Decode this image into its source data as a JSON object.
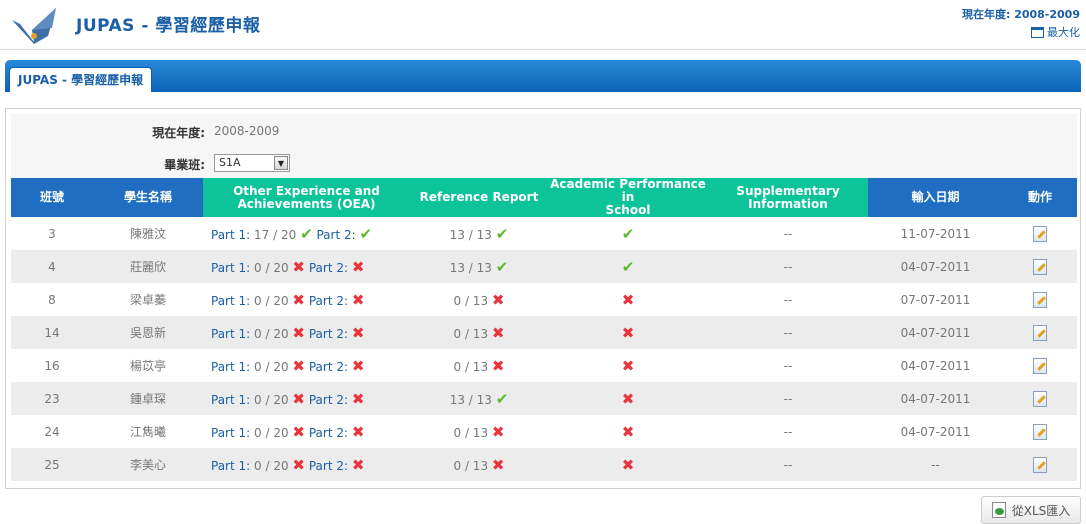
{
  "header": {
    "title": "JUPAS - 學習經歷申報",
    "year_label": "現在年度: 2008-2009",
    "maximize_label": "最大化"
  },
  "band": {
    "tab_label": "JUPAS - 學習經歷申報"
  },
  "filters": {
    "year_label": "現在年度:",
    "year_value": "2008-2009",
    "class_label": "畢業班:",
    "class_value": "S1A"
  },
  "table": {
    "headers": {
      "class_no": "班號",
      "student_name": "學生名稱",
      "oea_line1": "Other Experience and",
      "oea_line2": "Achievements (OEA)",
      "reference": "Reference Report",
      "academic_line1": "Academic Performance in",
      "academic_line2": "School",
      "supp_line1": "Supplementary",
      "supp_line2": "Information",
      "input_date": "輸入日期",
      "action": "動作"
    },
    "part1_label": "Part 1:",
    "part2_label": "Part 2:",
    "rows": [
      {
        "no": "3",
        "name": "陳雅汶",
        "oea": "17 / 20",
        "p1": "ok",
        "p2": "ok",
        "ref": "13 / 13",
        "ref_s": "ok",
        "acad": "ok",
        "supp": "--",
        "date": "11-07-2011"
      },
      {
        "no": "4",
        "name": "莊麗欣",
        "oea": "0 / 20",
        "p1": "bad",
        "p2": "bad",
        "ref": "13 / 13",
        "ref_s": "ok",
        "acad": "ok",
        "supp": "--",
        "date": "04-07-2011"
      },
      {
        "no": "8",
        "name": "梁卓蓁",
        "oea": "0 / 20",
        "p1": "bad",
        "p2": "bad",
        "ref": "0 / 13",
        "ref_s": "bad",
        "acad": "bad",
        "supp": "--",
        "date": "07-07-2011"
      },
      {
        "no": "14",
        "name": "吳恩新",
        "oea": "0 / 20",
        "p1": "bad",
        "p2": "bad",
        "ref": "0 / 13",
        "ref_s": "bad",
        "acad": "bad",
        "supp": "--",
        "date": "04-07-2011"
      },
      {
        "no": "16",
        "name": "楊苡亭",
        "oea": "0 / 20",
        "p1": "bad",
        "p2": "bad",
        "ref": "0 / 13",
        "ref_s": "bad",
        "acad": "bad",
        "supp": "--",
        "date": "04-07-2011"
      },
      {
        "no": "23",
        "name": "鍾卓琛",
        "oea": "0 / 20",
        "p1": "bad",
        "p2": "bad",
        "ref": "13 / 13",
        "ref_s": "ok",
        "acad": "bad",
        "supp": "--",
        "date": "04-07-2011"
      },
      {
        "no": "24",
        "name": "江雋曦",
        "oea": "0 / 20",
        "p1": "bad",
        "p2": "bad",
        "ref": "0 / 13",
        "ref_s": "bad",
        "acad": "bad",
        "supp": "--",
        "date": "04-07-2011"
      },
      {
        "no": "25",
        "name": "李美心",
        "oea": "0 / 20",
        "p1": "bad",
        "p2": "bad",
        "ref": "0 / 13",
        "ref_s": "bad",
        "acad": "bad",
        "supp": "--",
        "date": "--"
      }
    ]
  },
  "import_button": {
    "label": "從XLS匯入"
  },
  "icons": {
    "ok": "check-icon",
    "bad": "cross-icon",
    "edit": "edit-icon"
  },
  "colors": {
    "brand_blue": "#1f6ec2",
    "header_green": "#0dc39a",
    "ok_green": "#5fb92c",
    "bad_red": "#e8343a"
  }
}
